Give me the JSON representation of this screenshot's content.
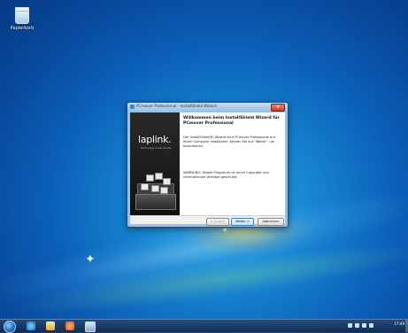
{
  "desktop": {
    "recycle_bin_label": "Papierkorb"
  },
  "dialog": {
    "title": "PCmover Professional - InstallShield Wizard",
    "close_glyph": "×",
    "logo_text": "laplink.",
    "logo_tagline": "technology made simple",
    "heading": "Willkommen beim InstallShield Wizard für PCmover Professional",
    "paragraph1": "Der InstallShield(R) Wizard wird PCmover Professional auf Ihrem Computer installieren. Klicken Sie auf \"Weiter\", um fortzufahren.",
    "paragraph2": "WARNUNG: Dieses Programm ist durch Copyright und internationale Verträge geschützt.",
    "buttons": {
      "back": "< Zurück",
      "next": "Weiter >",
      "cancel": "Abbrechen"
    }
  },
  "taskbar": {
    "clock_time": "17:49"
  },
  "colors": {
    "accent": "#1681cf",
    "close_button": "#c0392b"
  }
}
